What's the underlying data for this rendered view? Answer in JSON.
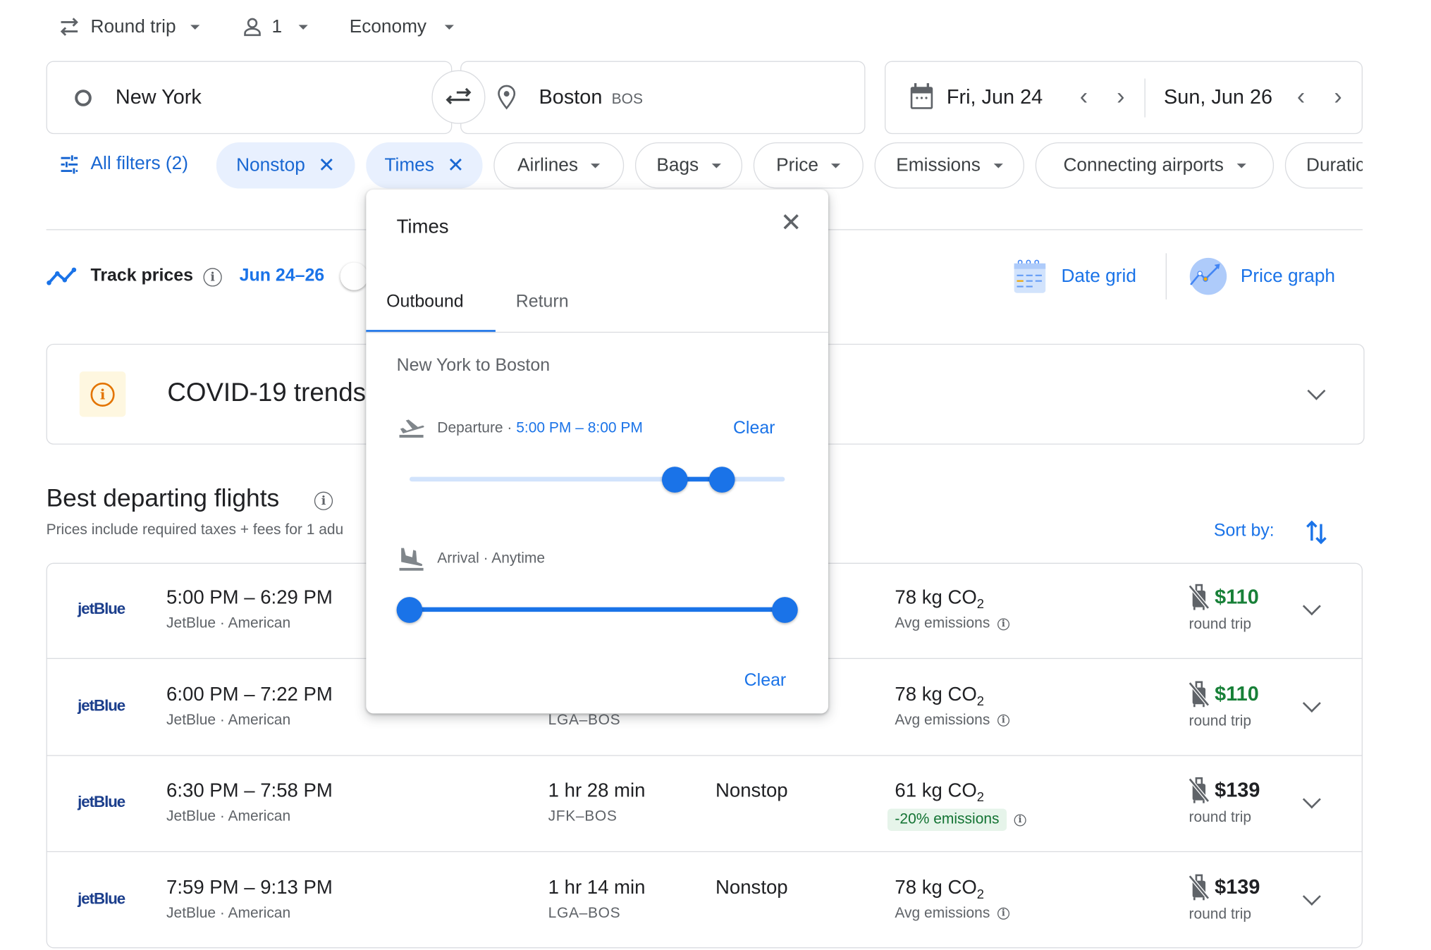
{
  "search_options": {
    "trip_type": "Round trip",
    "passengers": "1",
    "cabin_class": "Economy"
  },
  "search": {
    "origin": "New York",
    "destination": "Boston",
    "destination_code": "BOS",
    "depart_date": "Fri, Jun 24",
    "return_date": "Sun, Jun 26"
  },
  "filters": {
    "all_filters_label": "All filters (2)",
    "chips": [
      {
        "label": "Nonstop",
        "active": true
      },
      {
        "label": "Times",
        "active": true
      },
      {
        "label": "Airlines",
        "active": false
      },
      {
        "label": "Bags",
        "active": false
      },
      {
        "label": "Price",
        "active": false
      },
      {
        "label": "Emissions",
        "active": false
      },
      {
        "label": "Connecting airports",
        "active": false
      },
      {
        "label": "Duratic",
        "active": false
      }
    ]
  },
  "track_prices": {
    "label": "Track prices",
    "dates": "Jun 24–26",
    "enabled": false
  },
  "views": {
    "date_grid": "Date grid",
    "price_graph": "Price graph"
  },
  "covid_banner": {
    "title": "COVID-19 trends"
  },
  "results": {
    "heading": "Best departing flights",
    "subheading": "Prices include required taxes + fees for 1 adu",
    "sort_label": "Sort by:",
    "flights": [
      {
        "logo": "jetBlue",
        "times": "5:00 PM – 6:29 PM",
        "airlines": "JetBlue · American",
        "duration": "",
        "route": "",
        "stops": "",
        "co2": "78 kg CO",
        "emissions": "Avg emissions",
        "emissions_good": false,
        "price": "$110",
        "price_color": "#188038",
        "price_note": "round trip"
      },
      {
        "logo": "jetBlue",
        "times": "6:00 PM – 7:22 PM",
        "airlines": "JetBlue · American",
        "duration": "",
        "route": "LGA–BOS",
        "stops": "",
        "co2": "78 kg CO",
        "emissions": "Avg emissions",
        "emissions_good": false,
        "price": "$110",
        "price_color": "#188038",
        "price_note": "round trip"
      },
      {
        "logo": "jetBlue",
        "times": "6:30 PM – 7:58 PM",
        "airlines": "JetBlue · American",
        "duration": "1 hr 28 min",
        "route": "JFK–BOS",
        "stops": "Nonstop",
        "co2": "61 kg CO",
        "emissions": "-20% emissions",
        "emissions_good": true,
        "price": "$139",
        "price_color": "#202124",
        "price_note": "round trip"
      },
      {
        "logo": "jetBlue",
        "times": "7:59 PM – 9:13 PM",
        "airlines": "JetBlue · American",
        "duration": "1 hr 14 min",
        "route": "LGA–BOS",
        "stops": "Nonstop",
        "co2": "78 kg CO",
        "emissions": "Avg emissions",
        "emissions_good": false,
        "price": "$139",
        "price_color": "#202124",
        "price_note": "round trip"
      }
    ]
  },
  "times_popup": {
    "title": "Times",
    "tabs": [
      {
        "label": "Outbound",
        "active": true
      },
      {
        "label": "Return",
        "active": false
      }
    ],
    "route_label": "New York to Boston",
    "departure": {
      "label": "Departure",
      "value": "5:00 PM – 8:00 PM",
      "clear_label": "Clear",
      "range_fraction": [
        0.708,
        0.833
      ]
    },
    "arrival": {
      "label": "Arrival",
      "value": "Anytime",
      "range_fraction": [
        0,
        1
      ]
    },
    "clear_label": "Clear"
  },
  "colors": {
    "accent": "#1a73e8",
    "chip_active_bg": "#e8f0fe",
    "price_green": "#188038",
    "emissions_good_bg": "#e6f4ea",
    "covid_icon": "#e37400"
  }
}
